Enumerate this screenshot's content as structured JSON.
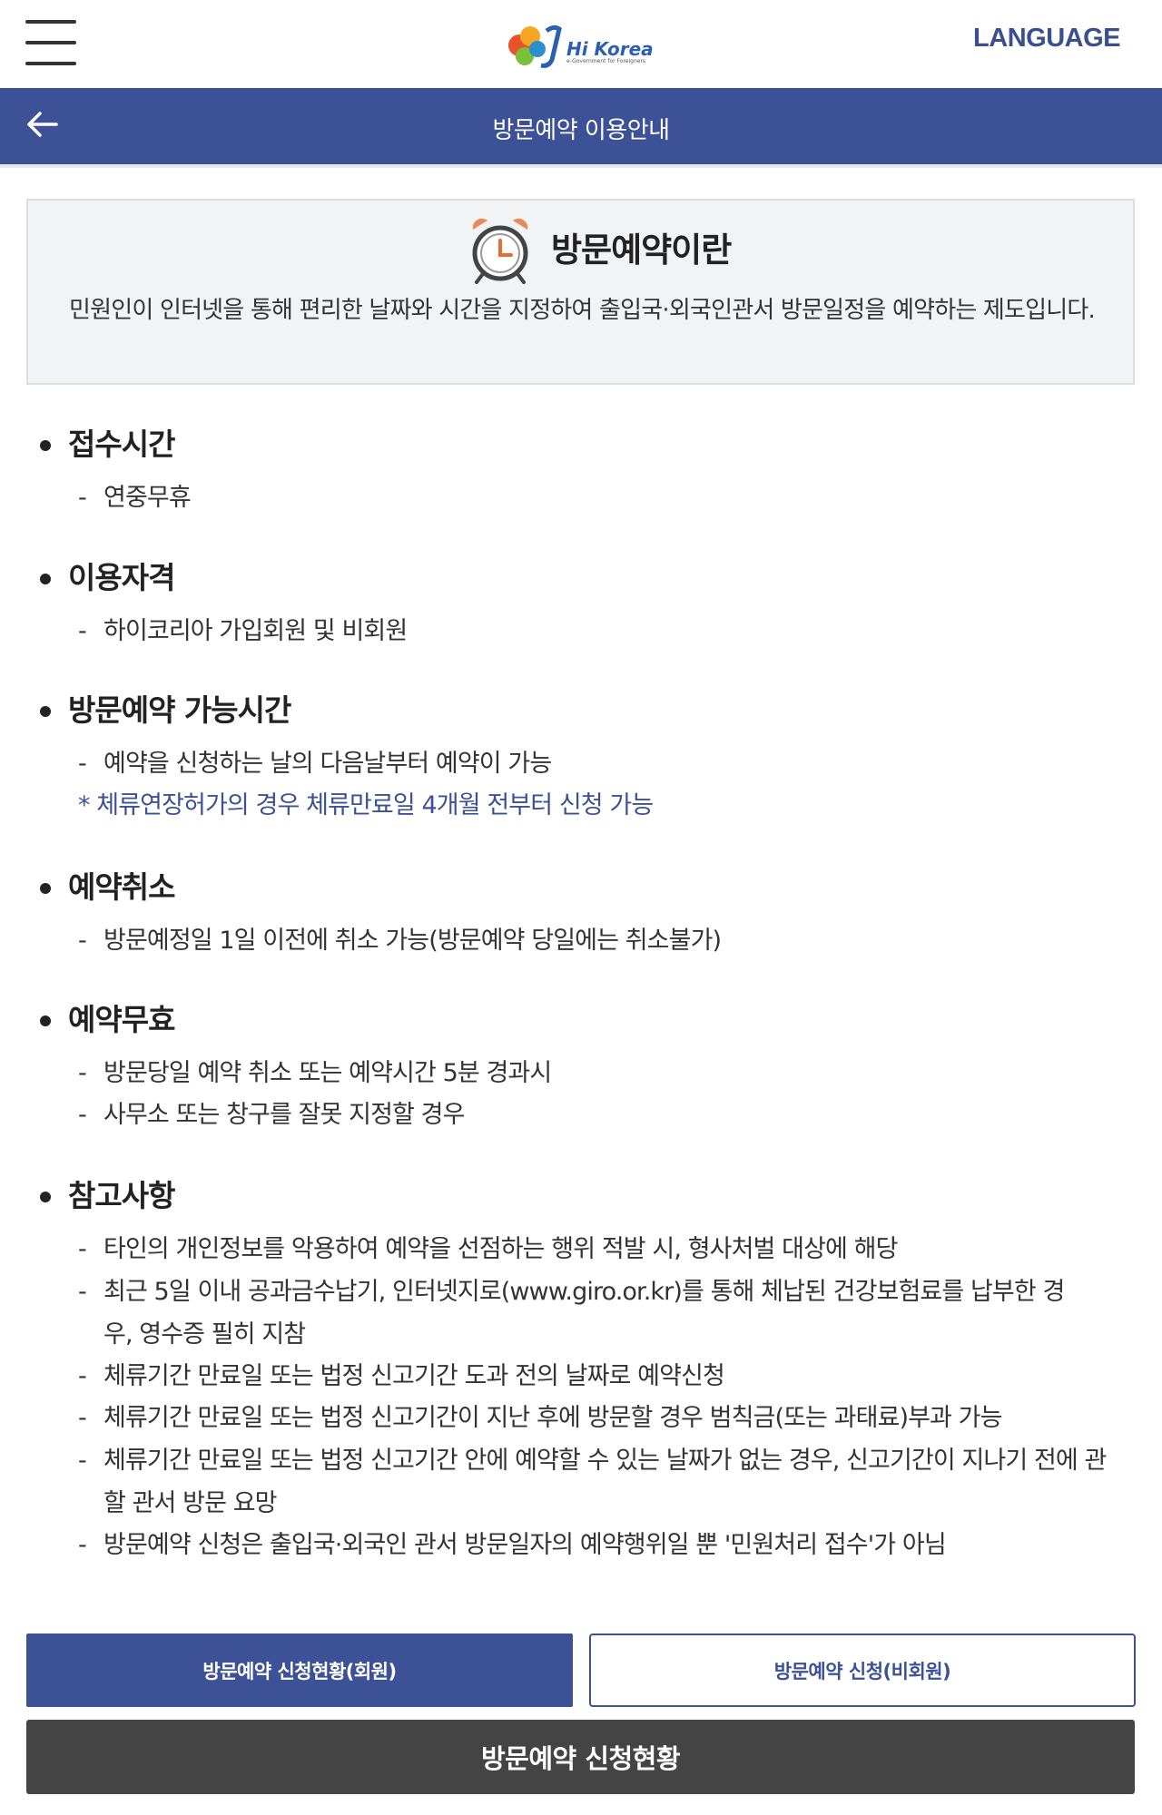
{
  "header": {
    "logo_text": "Hi Korea",
    "logo_sub": "e-Government for Foreigners",
    "language_label": "LANGUAGE"
  },
  "titlebar": {
    "title": "방문예약 이용안내"
  },
  "intro": {
    "title": "방문예약이란",
    "description": "민원인이 인터넷을 통해 편리한 날짜와 시간을 지정하여 출입국·외국인관서 방문일정을 예약하는 제도입니다."
  },
  "sections": [
    {
      "title": "접수시간",
      "items": [
        "연중무휴"
      ]
    },
    {
      "title": "이용자격",
      "items": [
        "하이코리아 가입회원 및 비회원"
      ]
    },
    {
      "title": "방문예약 가능시간",
      "items": [
        "예약을 신청하는 날의 다음날부터 예약이 가능"
      ],
      "note": "* 체류연장허가의 경우 체류만료일 4개월 전부터 신청 가능"
    },
    {
      "title": "예약취소",
      "items": [
        "방문예정일 1일 이전에 취소 가능(방문예약 당일에는 취소불가)"
      ]
    },
    {
      "title": "예약무효",
      "items": [
        "방문당일 예약 취소 또는 예약시간 5분 경과시",
        "사무소 또는 창구를 잘못 지정할 경우"
      ]
    },
    {
      "title": "참고사항",
      "items": [
        "타인의 개인정보를 악용하여 예약을 선점하는 행위 적발 시, 형사처벌 대상에 해당",
        "최근 5일 이내 공과금수납기, 인터넷지로(www.giro.or.kr)를 통해 체납된 건강보험료를 납부한 경우, 영수증 필히 지참",
        "체류기간 만료일 또는 법정 신고기간 도과 전의 날짜로 예약신청",
        "체류기간 만료일 또는 법정 신고기간이 지난 후에 방문할 경우 범칙금(또는 과태료)부과 가능",
        "체류기간 만료일 또는 법정 신고기간 안에 예약할 수 있는 날짜가 없는 경우, 신고기간이 지나기 전에 관할 관서 방문 요망",
        "방문예약 신청은 출입국·외국인 관서 방문일자의 예약행위일 뿐 '민원처리 접수'가 아님"
      ]
    }
  ],
  "item_dash": "-",
  "buttons": {
    "member": "방문예약 신청현황(회원)",
    "nonmember": "방문예약 신청(비회원)",
    "status": "방문예약 신청현황"
  },
  "colors": {
    "primary": "#3c5196",
    "dark_button": "#444444",
    "intro_bg": "#f2f3f5"
  },
  "icons": {
    "menu": "hamburger-menu-icon",
    "back": "arrow-left-icon",
    "intro": "alarm-clock-icon"
  }
}
